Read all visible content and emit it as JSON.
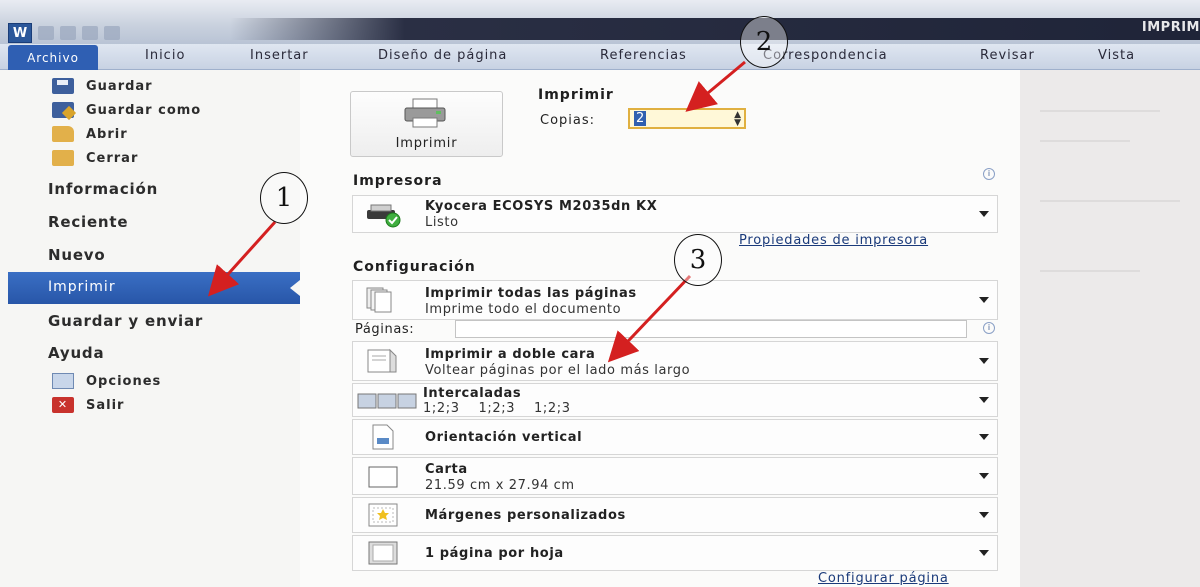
{
  "titlebar": {
    "app_logo": "W",
    "window_title": "IMPRIM"
  },
  "tabs": [
    "Archivo",
    "Inicio",
    "Insertar",
    "Diseño de página",
    "Referencias",
    "Correspondencia",
    "Revisar",
    "Vista"
  ],
  "nav": {
    "guardar": "Guardar",
    "guardar_como": "Guardar como",
    "abrir": "Abrir",
    "cerrar": "Cerrar",
    "informacion": "Información",
    "reciente": "Reciente",
    "nuevo": "Nuevo",
    "imprimir": "Imprimir",
    "guardar_enviar": "Guardar y enviar",
    "ayuda": "Ayuda",
    "opciones": "Opciones",
    "salir": "Salir"
  },
  "print": {
    "button_label": "Imprimir",
    "heading": "Imprimir",
    "copies_label": "Copias:",
    "copies_value": "2"
  },
  "printer": {
    "heading": "Impresora",
    "name": "Kyocera ECOSYS M2035dn KX",
    "status": "Listo",
    "properties_link": "Propiedades de impresora"
  },
  "settings": {
    "heading": "Configuración",
    "pages_label": "Páginas:",
    "items": [
      {
        "main": "Imprimir todas las páginas",
        "sub": "Imprime todo el documento"
      },
      {
        "main": "Imprimir a doble cara",
        "sub": "Voltear páginas por el lado más largo"
      },
      {
        "main": "Intercaladas",
        "sub": "1;2;3    1;2;3    1;2;3"
      },
      {
        "main": "Orientación vertical",
        "sub": ""
      },
      {
        "main": "Carta",
        "sub": "21.59 cm x 27.94 cm"
      },
      {
        "main": "Márgenes personalizados",
        "sub": ""
      },
      {
        "main": "1 página por hoja",
        "sub": ""
      }
    ],
    "page_setup_link": "Configurar página"
  },
  "annotations": [
    "1",
    "2",
    "3"
  ],
  "colors": {
    "selected_nav": "#2856a8",
    "annotation_arrow": "#d42020",
    "copies_highlight": "#e0b040"
  }
}
